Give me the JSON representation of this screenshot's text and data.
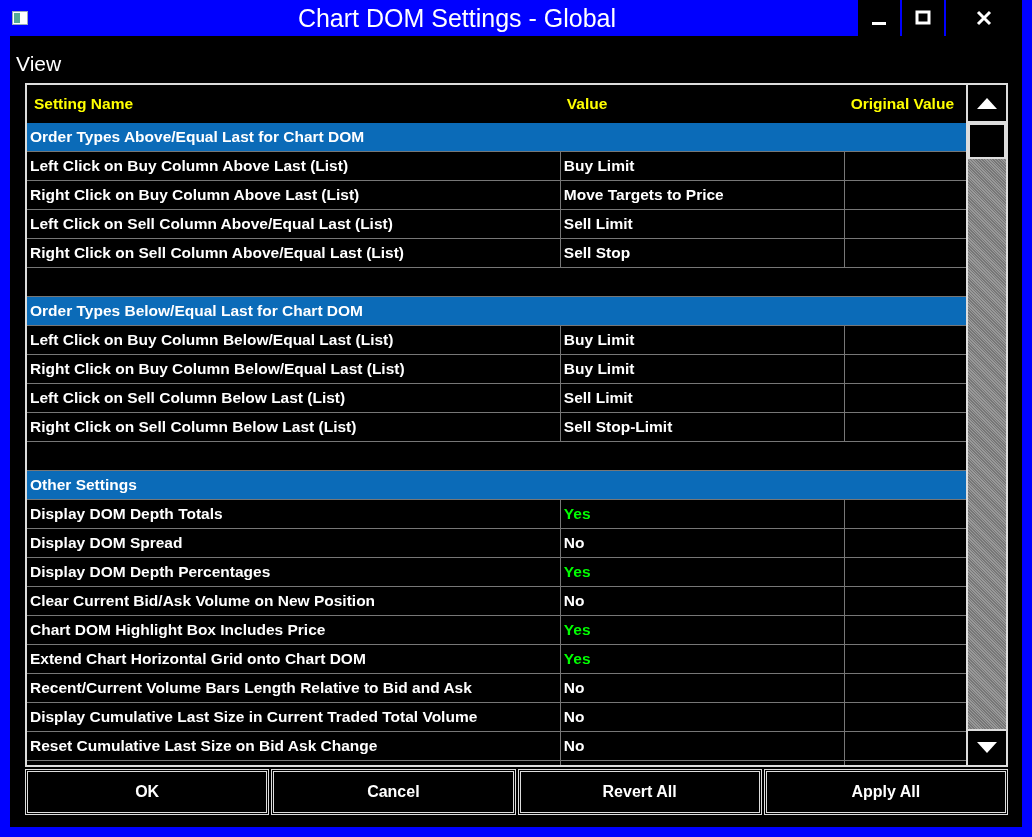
{
  "window": {
    "title": "Chart DOM Settings - Global"
  },
  "menu": {
    "label": "View"
  },
  "columns": [
    "Setting Name",
    "Value",
    "Original Value"
  ],
  "rows": [
    {
      "kind": "group",
      "name": "Order Types Above/Equal Last for Chart DOM"
    },
    {
      "kind": "setting",
      "name": "Left Click on Buy Column Above Last (List)",
      "value": "Buy Limit",
      "color": "#ffffff"
    },
    {
      "kind": "setting",
      "name": "Right Click on Buy Column Above Last (List)",
      "value": "Move Targets to Price",
      "color": "#ffffff"
    },
    {
      "kind": "setting",
      "name": "Left Click on Sell Column Above/Equal Last (List)",
      "value": "Sell Limit",
      "color": "#ffffff"
    },
    {
      "kind": "setting",
      "name": "Right Click on Sell Column Above/Equal Last (List)",
      "value": "Sell Stop",
      "color": "#ffffff"
    },
    {
      "kind": "spacer"
    },
    {
      "kind": "group",
      "name": "Order Types Below/Equal Last for Chart DOM"
    },
    {
      "kind": "setting",
      "name": "Left Click on Buy Column Below/Equal Last (List)",
      "value": "Buy Limit",
      "color": "#ffffff"
    },
    {
      "kind": "setting",
      "name": "Right Click on Buy Column Below/Equal Last (List)",
      "value": "Buy Limit",
      "color": "#ffffff"
    },
    {
      "kind": "setting",
      "name": "Left Click on Sell Column Below Last (List)",
      "value": "Sell Limit",
      "color": "#ffffff"
    },
    {
      "kind": "setting",
      "name": "Right Click on Sell Column Below Last (List)",
      "value": "Sell Stop-Limit",
      "color": "#ffffff"
    },
    {
      "kind": "spacer"
    },
    {
      "kind": "group",
      "name": "Other Settings"
    },
    {
      "kind": "setting",
      "name": "Display DOM Depth Totals",
      "value": "Yes",
      "color": "#00ff00"
    },
    {
      "kind": "setting",
      "name": "Display DOM Spread",
      "value": "No",
      "color": "#ffffff"
    },
    {
      "kind": "setting",
      "name": "Display DOM Depth Percentages",
      "value": "Yes",
      "color": "#00ff00"
    },
    {
      "kind": "setting",
      "name": "Clear Current Bid/Ask Volume on New Position",
      "value": "No",
      "color": "#ffffff"
    },
    {
      "kind": "setting",
      "name": "Chart DOM Highlight Box Includes Price",
      "value": "Yes",
      "color": "#00ff00"
    },
    {
      "kind": "setting",
      "name": "Extend Chart Horizontal Grid onto Chart DOM",
      "value": "Yes",
      "color": "#00ff00"
    },
    {
      "kind": "setting",
      "name": "Recent/Current Volume Bars Length Relative to Bid and Ask",
      "value": "No",
      "color": "#ffffff"
    },
    {
      "kind": "setting",
      "name": "Display Cumulative Last Size in Current Traded Total Volume",
      "value": "No",
      "color": "#ffffff"
    },
    {
      "kind": "setting",
      "name": "Reset Cumulative Last Size on Bid Ask Change",
      "value": "No",
      "color": "#ffffff"
    }
  ],
  "buttons": [
    "OK",
    "Cancel",
    "Revert All",
    "Apply All"
  ]
}
